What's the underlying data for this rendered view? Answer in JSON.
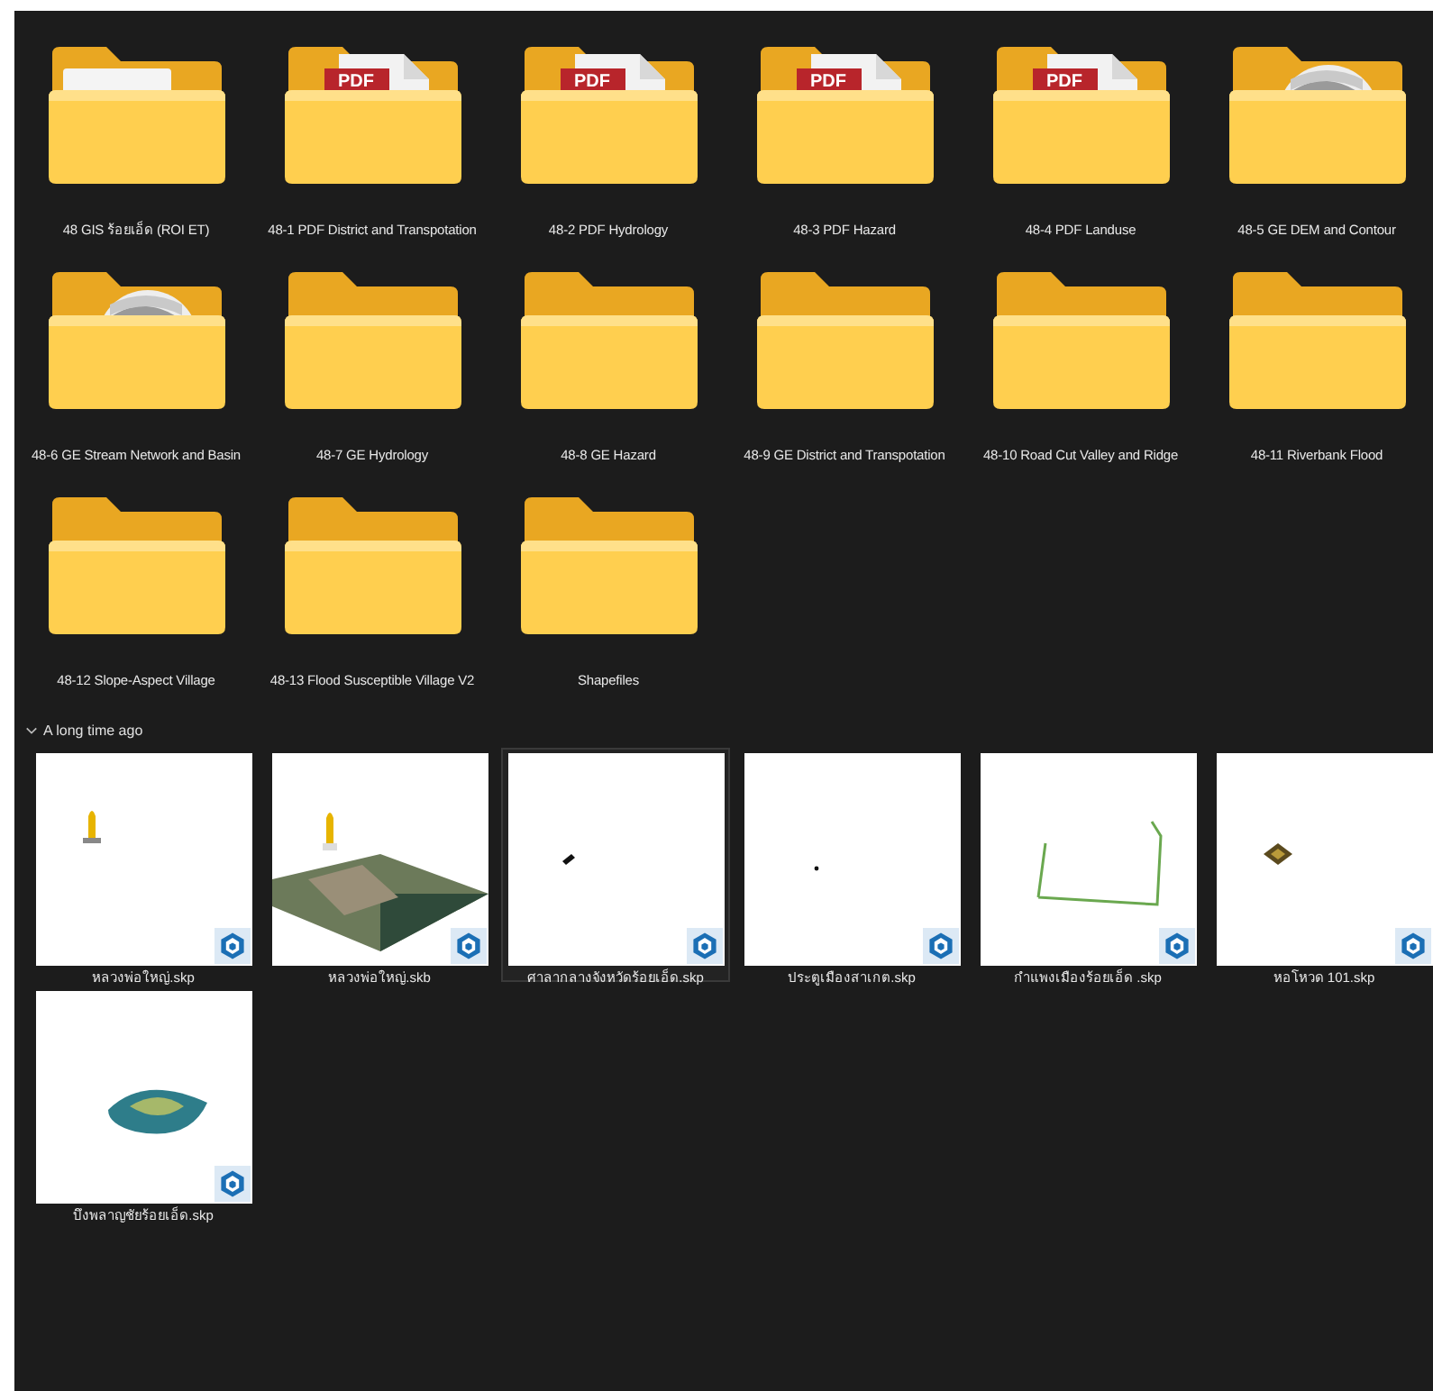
{
  "folders": [
    {
      "name": "48 GIS ร้อยเอ็ด (ROI ET)",
      "kind": "paper"
    },
    {
      "name": "48-1 PDF District and Transpotation",
      "kind": "pdf",
      "badge": "PDF"
    },
    {
      "name": "48-2 PDF Hydrology",
      "kind": "pdf",
      "badge": "PDF"
    },
    {
      "name": "48-3 PDF Hazard",
      "kind": "pdf",
      "badge": "PDF"
    },
    {
      "name": "48-4 PDF Landuse",
      "kind": "pdf",
      "badge": "PDF"
    },
    {
      "name": "48-5 GE DEM and Contour",
      "kind": "globe"
    },
    {
      "name": "48-6 GE Stream Network and Basin",
      "kind": "globe"
    },
    {
      "name": "48-7 GE Hydrology",
      "kind": "plain"
    },
    {
      "name": "48-8 GE Hazard",
      "kind": "plain"
    },
    {
      "name": "48-9 GE District and Transpotation",
      "kind": "plain"
    },
    {
      "name": "48-10 Road Cut Valley and Ridge",
      "kind": "plain"
    },
    {
      "name": "48-11 Riverbank Flood",
      "kind": "plain"
    },
    {
      "name": "48-12 Slope-Aspect Village",
      "kind": "plain"
    },
    {
      "name": "48-13 Flood Susceptible Village V2",
      "kind": "plain"
    },
    {
      "name": "Shapefiles",
      "kind": "plain"
    }
  ],
  "section": {
    "title": "A long time ago",
    "expanded": true
  },
  "files": [
    {
      "name": "หลวงพ่อใหญ่.skp",
      "kind": "picture",
      "selected": false
    },
    {
      "name": "หลวงพ่อใหญ่.skb",
      "kind": "picture",
      "selected": false
    },
    {
      "name": "ศาลากลางจังหวัดร้อยเอ็ด.skp",
      "kind": "picture",
      "selected": true
    },
    {
      "name": "ประตูเมืองสาเกต.skp",
      "kind": "picture",
      "selected": false
    },
    {
      "name": "กำแพงเมืองร้อยเอ็ด .skp",
      "kind": "picture",
      "selected": false
    },
    {
      "name": "หอโหวด 101.skp",
      "kind": "picture",
      "selected": false
    },
    {
      "name": "บึงพลาญชัยร้อยเอ็ด.skp",
      "kind": "picture",
      "selected": false
    }
  ]
}
